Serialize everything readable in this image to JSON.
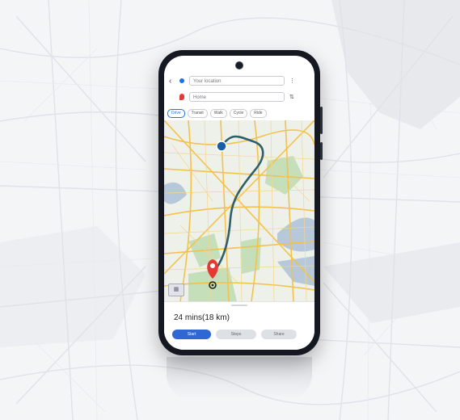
{
  "search": {
    "origin_placeholder": "Your location",
    "destination_value": "Home"
  },
  "modes": [
    {
      "label": "Drive",
      "active": true
    },
    {
      "label": "Transit"
    },
    {
      "label": "Walk"
    },
    {
      "label": "Cycle"
    },
    {
      "label": "Ride"
    }
  ],
  "route": {
    "eta": "24 mins(18 km)"
  },
  "actions": {
    "start": "Start",
    "steps": "Steps",
    "share": "Share"
  },
  "colors": {
    "route": "#2f5f69",
    "origin": "#1a5ea8",
    "destination": "#e53935",
    "roads": "#f2c24b",
    "water": "#b7c8da",
    "parks": "#c4dfb9"
  }
}
